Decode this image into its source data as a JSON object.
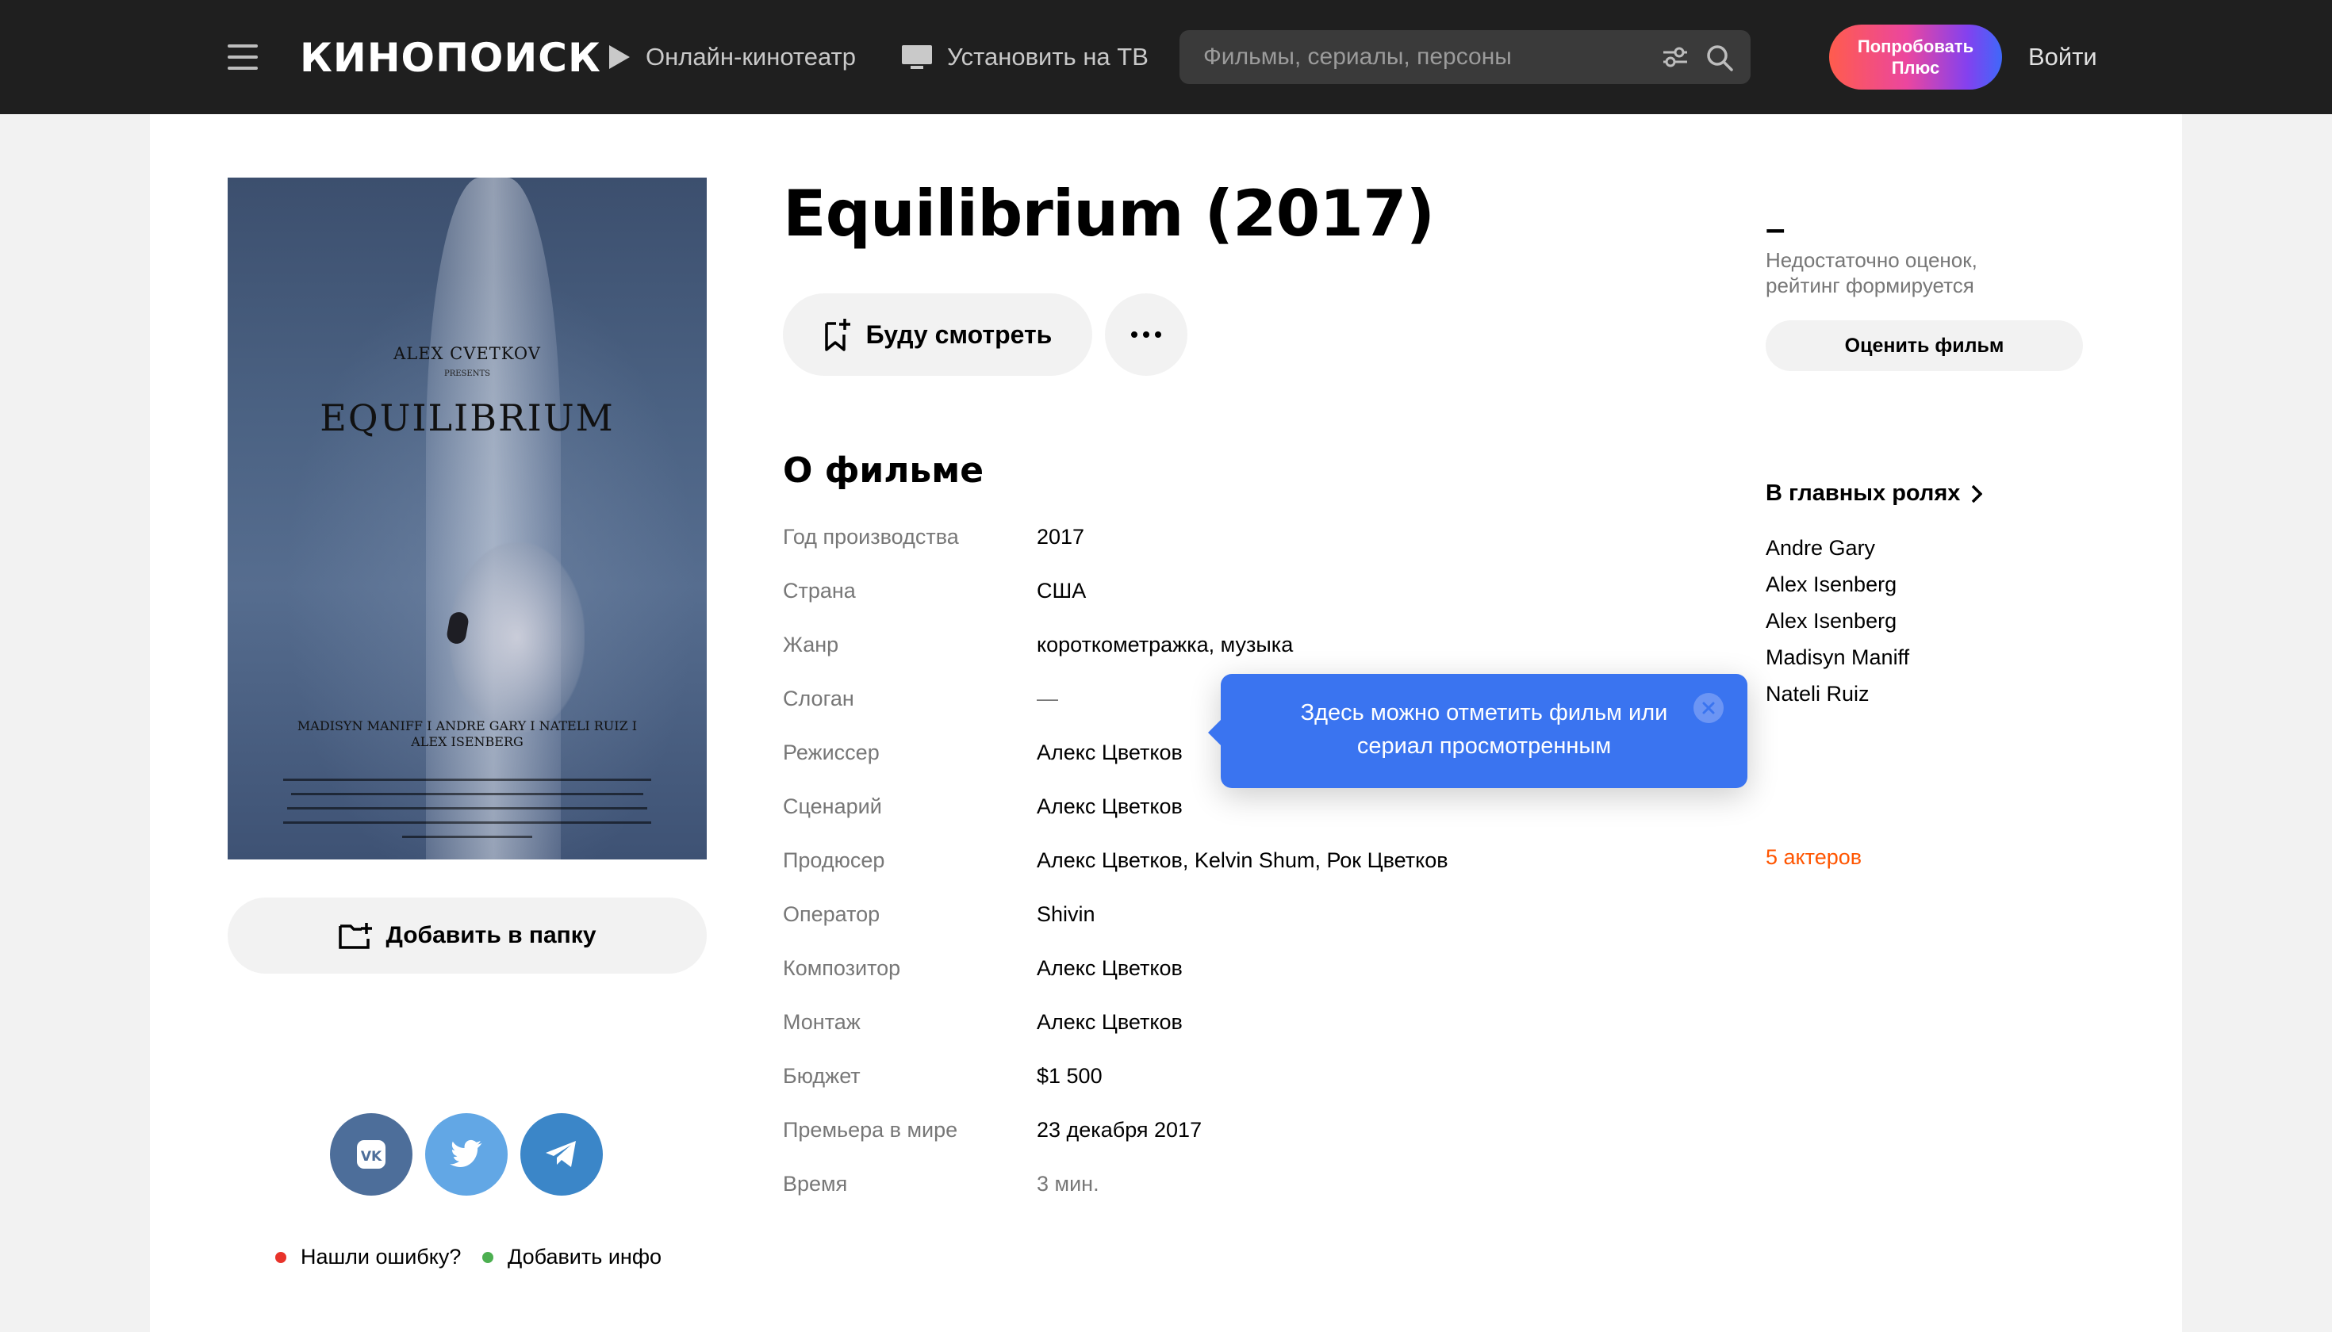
{
  "header": {
    "logo": "КИНОПОИСК",
    "nav_online": "Онлайн-кинотеатр",
    "nav_tv": "Установить на ТВ",
    "search_placeholder": "Фильмы, сериалы, персоны",
    "plus_line1": "Попробовать",
    "plus_line2": "Плюс",
    "login": "Войти"
  },
  "poster": {
    "presenter": "ALEX CVETKOV",
    "presents": "PRESENTS",
    "title": "EQUILIBRIUM",
    "cast_line1": "MADISYN MANIFF I ANDRE GARY I NATELI RUIZ I",
    "cast_line2": "ALEX ISENBERG"
  },
  "film": {
    "title": "Equilibrium (2017)",
    "watch_label": "Буду смотреть",
    "folder_label": "Добавить в папку",
    "about_heading": "О фильме",
    "info": [
      {
        "label": "Год производства",
        "value": "2017"
      },
      {
        "label": "Страна",
        "value": "США"
      },
      {
        "label": "Жанр",
        "value": "короткометражка, музыка"
      },
      {
        "label": "Слоган",
        "value": "—"
      },
      {
        "label": "Режиссер",
        "value": "Алекс Цветков"
      },
      {
        "label": "Сценарий",
        "value": "Алекс Цветков"
      },
      {
        "label": "Продюсер",
        "value": "Алекс Цветков, Kelvin Shum, Рок Цветков"
      },
      {
        "label": "Оператор",
        "value": "Shivin"
      },
      {
        "label": "Композитор",
        "value": "Алекс Цветков"
      },
      {
        "label": "Монтаж",
        "value": "Алекс Цветков"
      },
      {
        "label": "Бюджет",
        "value": "$1 500"
      },
      {
        "label": "Премьера в мире",
        "value": "23 декабря 2017"
      },
      {
        "label": "Время",
        "value": "3 мин."
      }
    ]
  },
  "tooltip": {
    "text": "Здесь можно отметить фильм или сериал просмотренным"
  },
  "rating": {
    "value": "–",
    "note": "Недостаточно оценок, рейтинг формируется",
    "rate_label": "Оценить фильм"
  },
  "cast": {
    "heading": "В главных ролях",
    "actors": [
      "Andre Gary",
      "Alex Isenberg",
      "Alex Isenberg",
      "Madisyn Maniff",
      "Nateli Ruiz"
    ],
    "more": "5 актеров"
  },
  "footer_links": {
    "error": "Нашли ошибку?",
    "info": "Добавить инфо"
  },
  "colors": {
    "header_bg": "#1f1f1f",
    "tooltip_bg": "#3a74f0",
    "accent_orange": "#ff5500",
    "error_dot": "#e8332a",
    "info_dot": "#4caf50",
    "vk": "#4d6e9a",
    "twitter": "#62a7e5",
    "telegram": "#3b86c8"
  },
  "icons": {
    "menu": "burger-menu-icon",
    "play": "play-icon",
    "tv": "tv-icon",
    "filter": "filter-icon",
    "search": "search-icon",
    "bookmark": "bookmark-plus-icon",
    "more": "more-dots-icon",
    "folder": "folder-plus-icon",
    "chevron": "chevron-right-icon",
    "close": "close-icon"
  }
}
